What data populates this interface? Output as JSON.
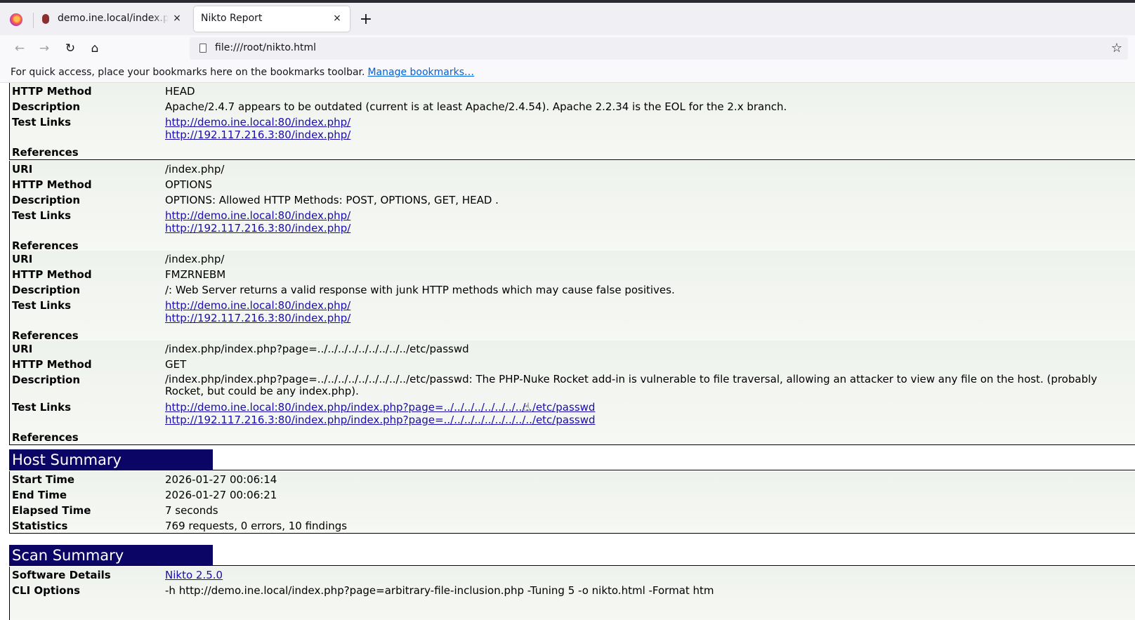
{
  "browser": {
    "tabs": [
      {
        "title": "demo.ine.local/index.php?page=arbitrary-file-inclusion.php",
        "close": "×"
      },
      {
        "title": "Nikto Report",
        "close": "×"
      }
    ],
    "new_tab": "+",
    "nav": {
      "back": "←",
      "forward": "→",
      "reload": "↻",
      "home": "⌂"
    },
    "url": "file:///root/nikto.html",
    "star": "☆",
    "bookmarks_text": "For quick access, place your bookmarks here on the bookmarks toolbar.",
    "bookmarks_link": "Manage bookmarks…"
  },
  "findings": [
    {
      "method_label": "HTTP Method",
      "method": "HEAD",
      "desc_label": "Description",
      "description": "Apache/2.4.7 appears to be outdated (current is at least Apache/2.4.54). Apache 2.2.34 is the EOL for the 2.x branch.",
      "links_label": "Test Links",
      "links": [
        "http://demo.ine.local:80/index.php/",
        "http://192.117.216.3:80/index.php/"
      ],
      "refs_label": "References"
    },
    {
      "uri_label": "URI",
      "uri": "/index.php/",
      "method_label": "HTTP Method",
      "method": "OPTIONS",
      "desc_label": "Description",
      "description": "OPTIONS: Allowed HTTP Methods: POST, OPTIONS, GET, HEAD .",
      "links_label": "Test Links",
      "links": [
        "http://demo.ine.local:80/index.php/",
        "http://192.117.216.3:80/index.php/"
      ],
      "refs_label": "References"
    },
    {
      "uri_label": "URI",
      "uri": "/index.php/",
      "method_label": "HTTP Method",
      "method": "FMZRNEBM",
      "desc_label": "Description",
      "description": "/: Web Server returns a valid response with junk HTTP methods which may cause false positives.",
      "links_label": "Test Links",
      "links": [
        "http://demo.ine.local:80/index.php/",
        "http://192.117.216.3:80/index.php/"
      ],
      "refs_label": "References"
    },
    {
      "uri_label": "URI",
      "uri": "/index.php/index.php?page=../../../../../../../../../etc/passwd",
      "method_label": "HTTP Method",
      "method": "GET",
      "desc_label": "Description",
      "description": "/index.php/index.php?page=../../../../../../../../../etc/passwd: The PHP-Nuke Rocket add-in is vulnerable to file traversal, allowing an attacker to view any file on the host. (probably Rocket, but could be any index.php).",
      "links_label": "Test Links",
      "links": [
        "http://demo.ine.local:80/index.php/index.php?page=../../../../../../../../../etc/passwd",
        "http://192.117.216.3:80/index.php/index.php?page=../../../../../../../../../etc/passwd"
      ],
      "refs_label": "References"
    }
  ],
  "host_summary": {
    "title": "Host Summary",
    "rows": [
      {
        "label": "Start Time",
        "value": "2026-01-27 00:06:14"
      },
      {
        "label": "End Time",
        "value": "2026-01-27 00:06:21"
      },
      {
        "label": "Elapsed Time",
        "value": "7 seconds"
      },
      {
        "label": "Statistics",
        "value": "769 requests, 0 errors, 10 findings"
      }
    ]
  },
  "scan_summary": {
    "title": "Scan Summary",
    "software_label": "Software Details",
    "software": "Nikto 2.5.0",
    "cli_label": "CLI Options",
    "cli": "-h http://demo.ine.local/index.php?page=arbitrary-file-inclusion.php -Tuning 5 -o nikto.html -Format htm"
  }
}
